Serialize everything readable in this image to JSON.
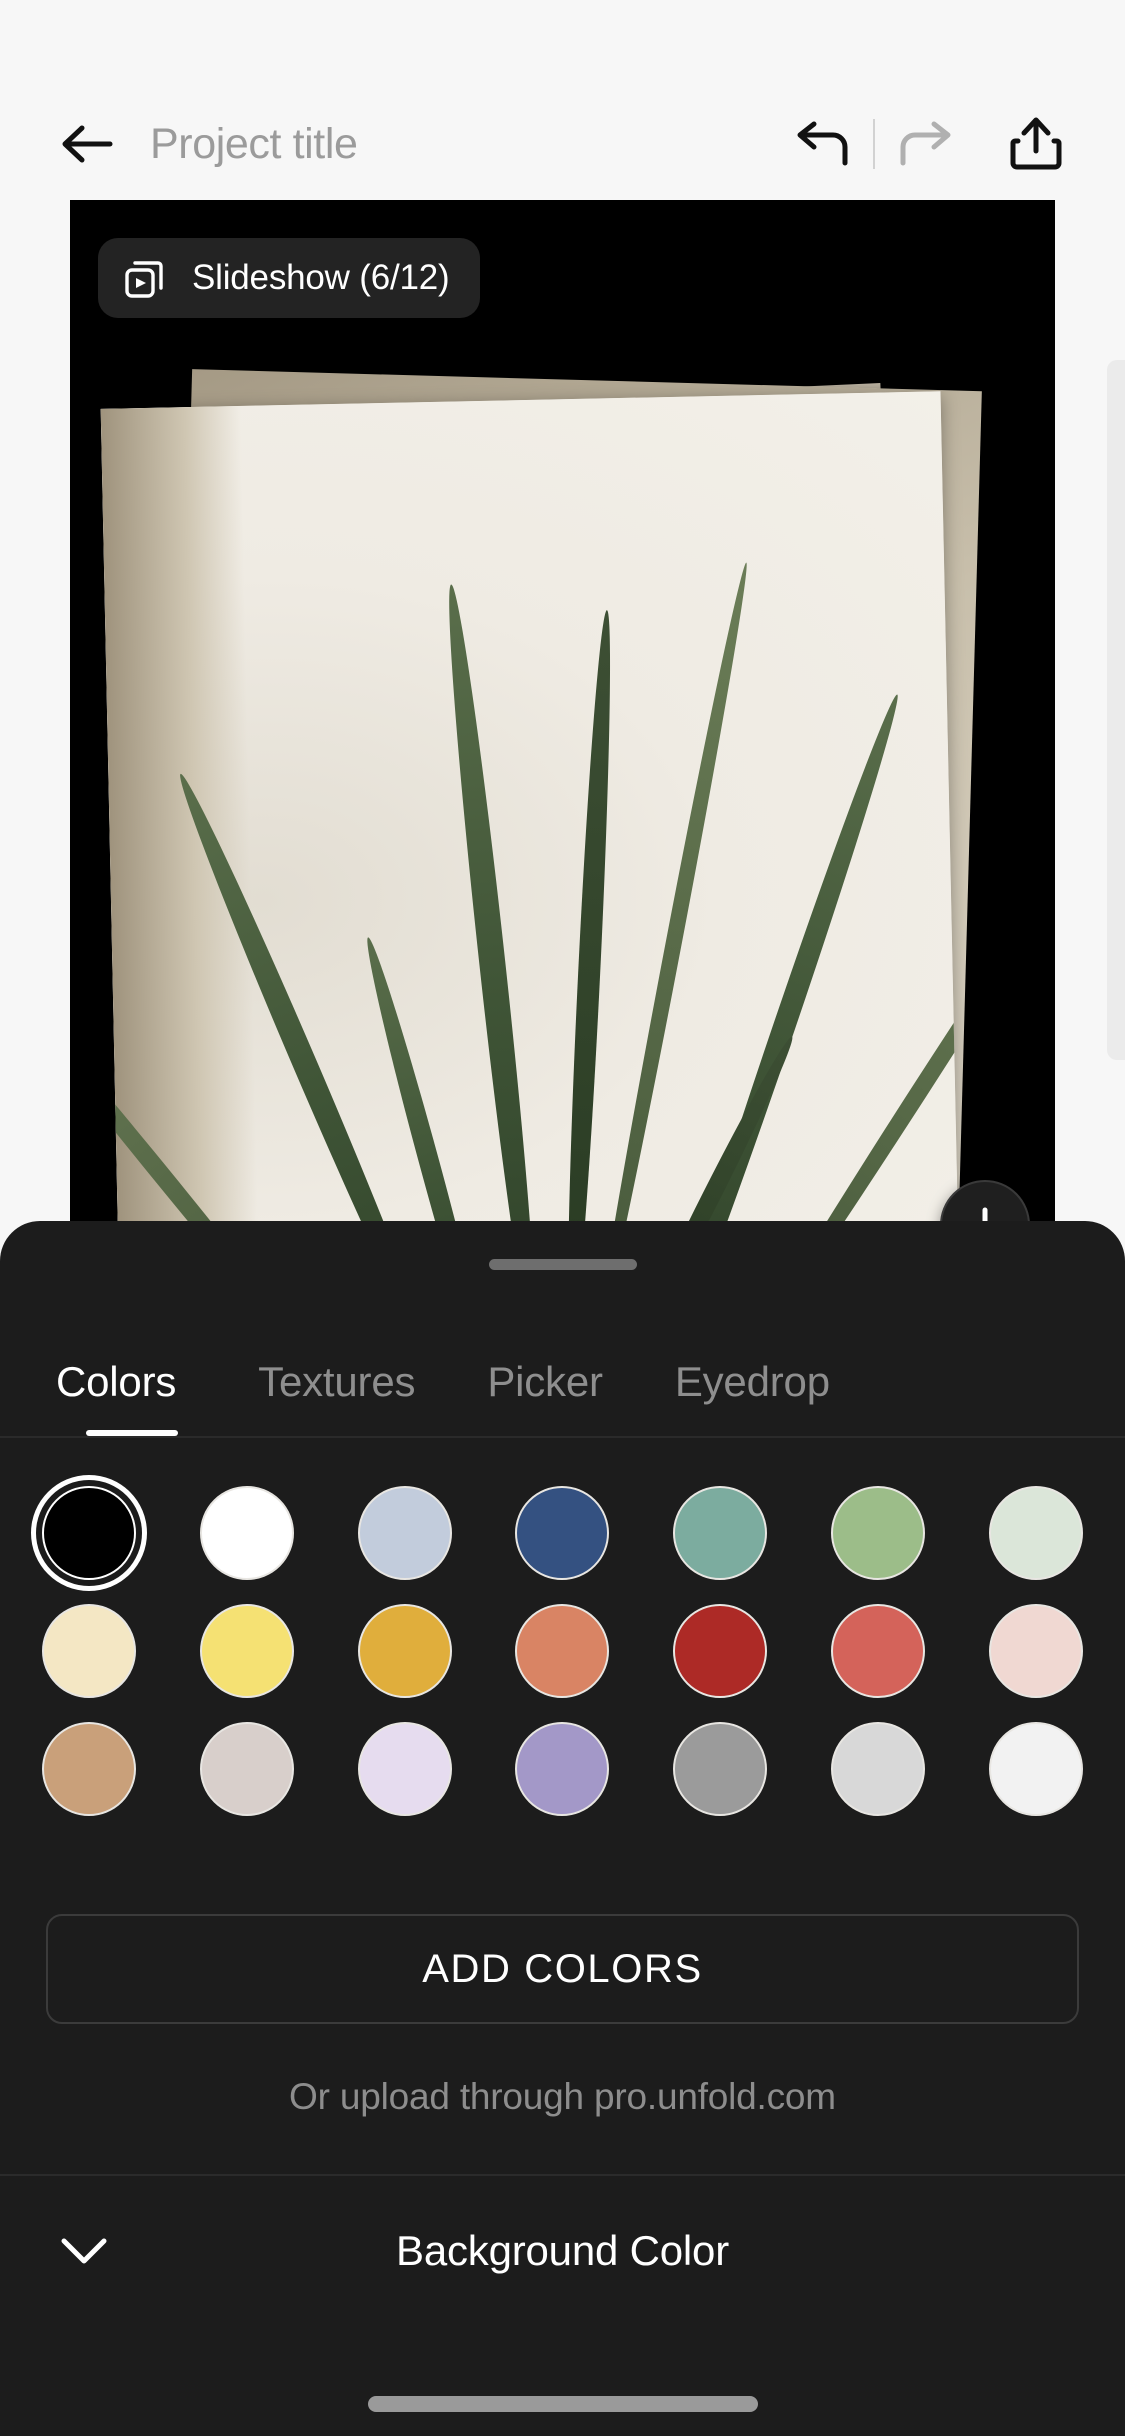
{
  "header": {
    "back_icon": "arrow-left-icon",
    "title_placeholder": "Project title",
    "title_value": "",
    "undo_icon": "undo-arrow-icon",
    "redo_icon": "redo-arrow-icon",
    "share_icon": "share-upload-icon"
  },
  "canvas": {
    "badge_icon": "slideshow-stack-play-icon",
    "badge_label": "Slideshow (6/12)",
    "slide_current": 6,
    "slide_total": 12,
    "add_icon": "plus-icon",
    "background_color": "#000000"
  },
  "panel": {
    "grabber": "drag-handle",
    "tabs": [
      {
        "label": "Colors",
        "active": true
      },
      {
        "label": "Textures",
        "active": false
      },
      {
        "label": "Picker",
        "active": false
      },
      {
        "label": "Eyedrop",
        "active": false
      }
    ],
    "swatch_rows": [
      [
        {
          "name": "black",
          "hex": "#000000",
          "selected": true
        },
        {
          "name": "white",
          "hex": "#ffffff",
          "selected": false
        },
        {
          "name": "powder-blue",
          "hex": "#c2ccdc",
          "selected": false
        },
        {
          "name": "navy-blue",
          "hex": "#345181",
          "selected": false
        },
        {
          "name": "teal-green",
          "hex": "#7cac9f",
          "selected": false
        },
        {
          "name": "sage-green",
          "hex": "#9cbd89",
          "selected": false
        },
        {
          "name": "pale-mint",
          "hex": "#dbe6d9",
          "selected": false
        }
      ],
      [
        {
          "name": "cream",
          "hex": "#f4e7c4",
          "selected": false
        },
        {
          "name": "yellow",
          "hex": "#f5e173",
          "selected": false
        },
        {
          "name": "golden-amber",
          "hex": "#e0ae3c",
          "selected": false
        },
        {
          "name": "terracotta",
          "hex": "#d98464",
          "selected": false
        },
        {
          "name": "dark-red",
          "hex": "#ad2a26",
          "selected": false
        },
        {
          "name": "coral-red",
          "hex": "#d4635a",
          "selected": false
        },
        {
          "name": "pale-pink",
          "hex": "#f0d8d2",
          "selected": false
        }
      ],
      [
        {
          "name": "tan",
          "hex": "#c9a07a",
          "selected": false
        },
        {
          "name": "warm-gray",
          "hex": "#d8cfcb",
          "selected": false
        },
        {
          "name": "pale-lavender",
          "hex": "#e6dcef",
          "selected": false
        },
        {
          "name": "purple",
          "hex": "#a398c8",
          "selected": false
        },
        {
          "name": "medium-gray",
          "hex": "#9b9b9b",
          "selected": false
        },
        {
          "name": "light-gray",
          "hex": "#d8d8d8",
          "selected": false
        },
        {
          "name": "off-white",
          "hex": "#f2f2f2",
          "selected": false
        }
      ]
    ],
    "add_colors_label": "ADD COLORS",
    "upload_note": "Or upload through pro.unfold.com",
    "footer_collapse_icon": "chevron-down-icon",
    "footer_title": "Background Color"
  }
}
